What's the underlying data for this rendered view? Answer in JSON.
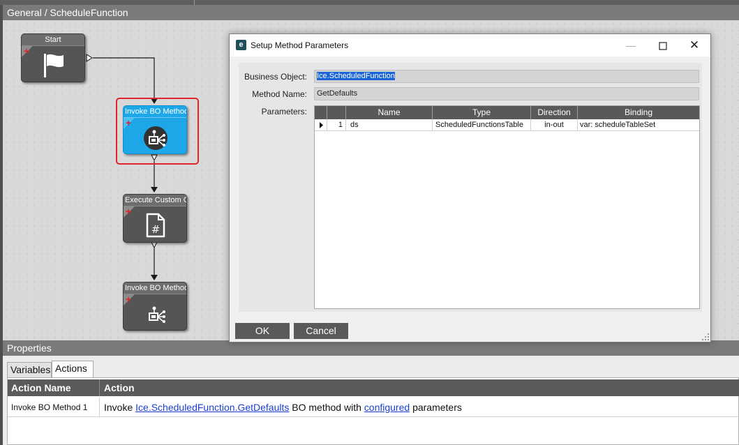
{
  "designer": {
    "breadcrumb": "General / ScheduleFunction",
    "nodes": {
      "start": {
        "title": "Start"
      },
      "invoke1": {
        "title": "Invoke BO Method"
      },
      "execute": {
        "title": "Execute Custom Co"
      },
      "invoke2": {
        "title": "Invoke BO Method"
      }
    }
  },
  "dialog": {
    "title": "Setup Method Parameters",
    "business_object_label": "Business Object:",
    "business_object_value": "Ice.ScheduledFunction",
    "method_name_label": "Method Name:",
    "method_name_value": "GetDefaults",
    "parameters_label": "Parameters:",
    "grid": {
      "headers": {
        "name": "Name",
        "type": "Type",
        "direction": "Direction",
        "binding": "Binding"
      },
      "rows": [
        {
          "num": "1",
          "name": "ds",
          "type": "ScheduledFunctionsTable",
          "direction": "in-out",
          "binding": "var: scheduleTableSet"
        }
      ]
    },
    "ok_label": "OK",
    "cancel_label": "Cancel"
  },
  "properties": {
    "header": "Properties",
    "tabs": {
      "variables": "Variables",
      "actions": "Actions"
    },
    "columns": {
      "action_name": "Action Name",
      "action": "Action"
    },
    "rows": [
      {
        "action_name": "Invoke BO Method 1",
        "prefix": "Invoke",
        "link_method": "Ice.ScheduledFunction.GetDefaults",
        "mid": "BO method with",
        "link_configured": "configured",
        "suffix": "parameters"
      }
    ]
  },
  "colors": {
    "selected_node": "#1ea7e8",
    "selection_ring": "#e3242b",
    "link": "#1a3fd0",
    "text_selection": "#1b64d8"
  },
  "icons": [
    "flag-icon",
    "invoke-bo-method-icon",
    "custom-code-icon",
    "plus-icon",
    "app-logo-icon",
    "minimize-icon",
    "maximize-icon",
    "close-icon",
    "row-pointer-icon",
    "resize-grip-icon"
  ]
}
